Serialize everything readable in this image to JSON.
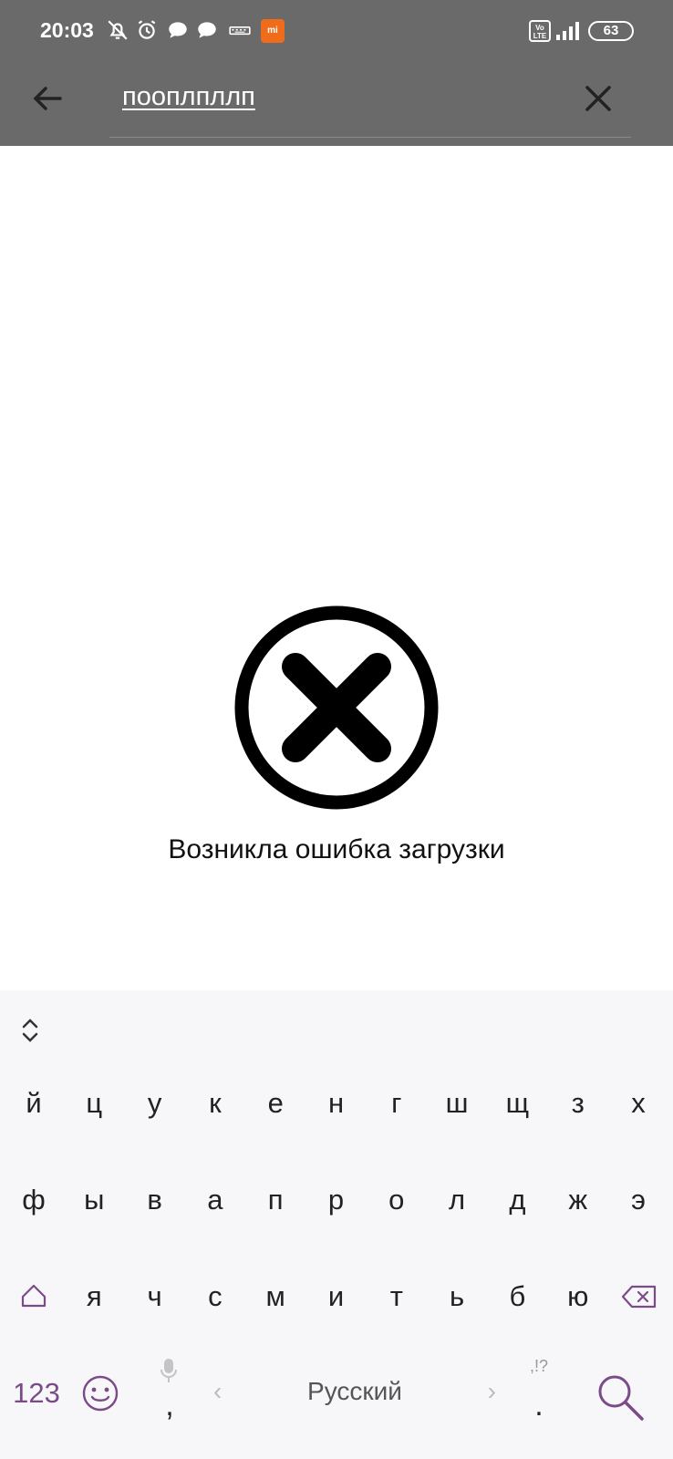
{
  "status_bar": {
    "time": "20:03",
    "icons": [
      "bell-off-icon",
      "alarm-icon",
      "chat-bubble-icon",
      "chat-bubble-icon",
      "keyboard-icon",
      "mi-app-icon"
    ],
    "mi_badge_text": "mi",
    "volte_text": "Vo LTE",
    "battery": "63"
  },
  "app_bar": {
    "search_value": "пооплпллп",
    "back_icon": "arrow-left-icon",
    "clear_icon": "close-icon",
    "background": "#6a6a6a"
  },
  "error": {
    "icon": "error-circle-x-icon",
    "message": "Возникла ошибка загрузки"
  },
  "keyboard": {
    "accent": "#7a4b87",
    "row1": [
      "й",
      "ц",
      "у",
      "к",
      "е",
      "н",
      "г",
      "ш",
      "щ",
      "з",
      "х"
    ],
    "row2": [
      "ф",
      "ы",
      "в",
      "а",
      "п",
      "р",
      "о",
      "л",
      "д",
      "ж",
      "э"
    ],
    "row3": [
      "я",
      "ч",
      "с",
      "м",
      "и",
      "т",
      "ь",
      "б",
      "ю"
    ],
    "num_label": "123",
    "comma": ",",
    "period": ".",
    "period_alt": ",!?",
    "space_label": "Русский",
    "space_arrow_left": "‹",
    "space_arrow_right": "›"
  }
}
